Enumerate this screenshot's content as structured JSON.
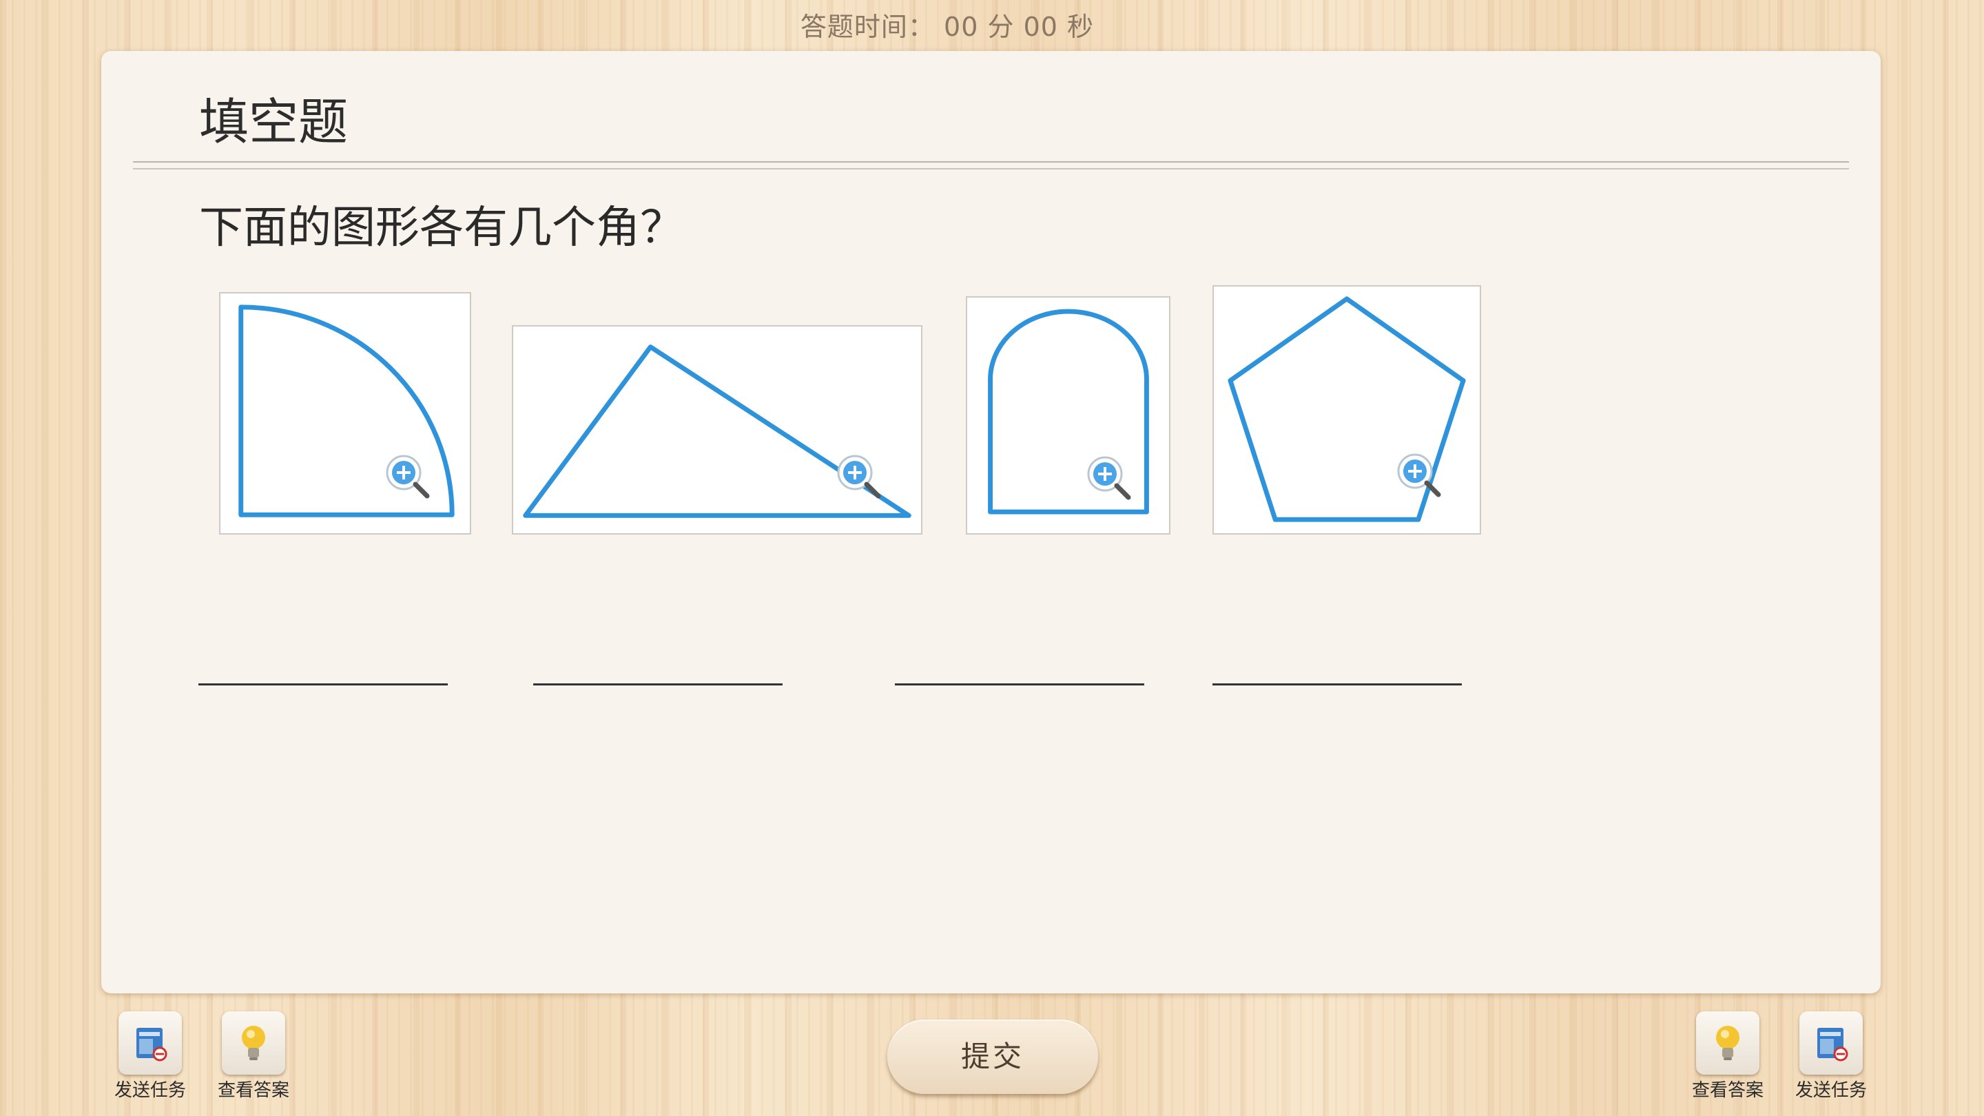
{
  "timer": {
    "label": "答题时间：",
    "minutes": "00",
    "minutes_unit": "分",
    "seconds": "00",
    "seconds_unit": "秒"
  },
  "card": {
    "title": "填空题",
    "question": "下面的图形各有几个角？",
    "figures": [
      {
        "shape": "quarter-circle",
        "zoom_icon": "zoom-in-magnifier-icon"
      },
      {
        "shape": "triangle",
        "zoom_icon": "zoom-in-magnifier-icon"
      },
      {
        "shape": "arch",
        "zoom_icon": "zoom-in-magnifier-icon"
      },
      {
        "shape": "pentagon",
        "zoom_icon": "zoom-in-magnifier-icon"
      }
    ],
    "answers": [
      "",
      "",
      "",
      ""
    ]
  },
  "toolbar": {
    "left": [
      {
        "label": "发送任务",
        "icon": "send-task-icon"
      },
      {
        "label": "查看答案",
        "icon": "lightbulb-icon"
      }
    ],
    "right": [
      {
        "label": "查看答案",
        "icon": "lightbulb-icon"
      },
      {
        "label": "发送任务",
        "icon": "send-task-icon"
      }
    ],
    "submit_label": "提交"
  },
  "colors": {
    "shape_stroke": "#2f93dc",
    "accent": "#4aa3e6"
  }
}
